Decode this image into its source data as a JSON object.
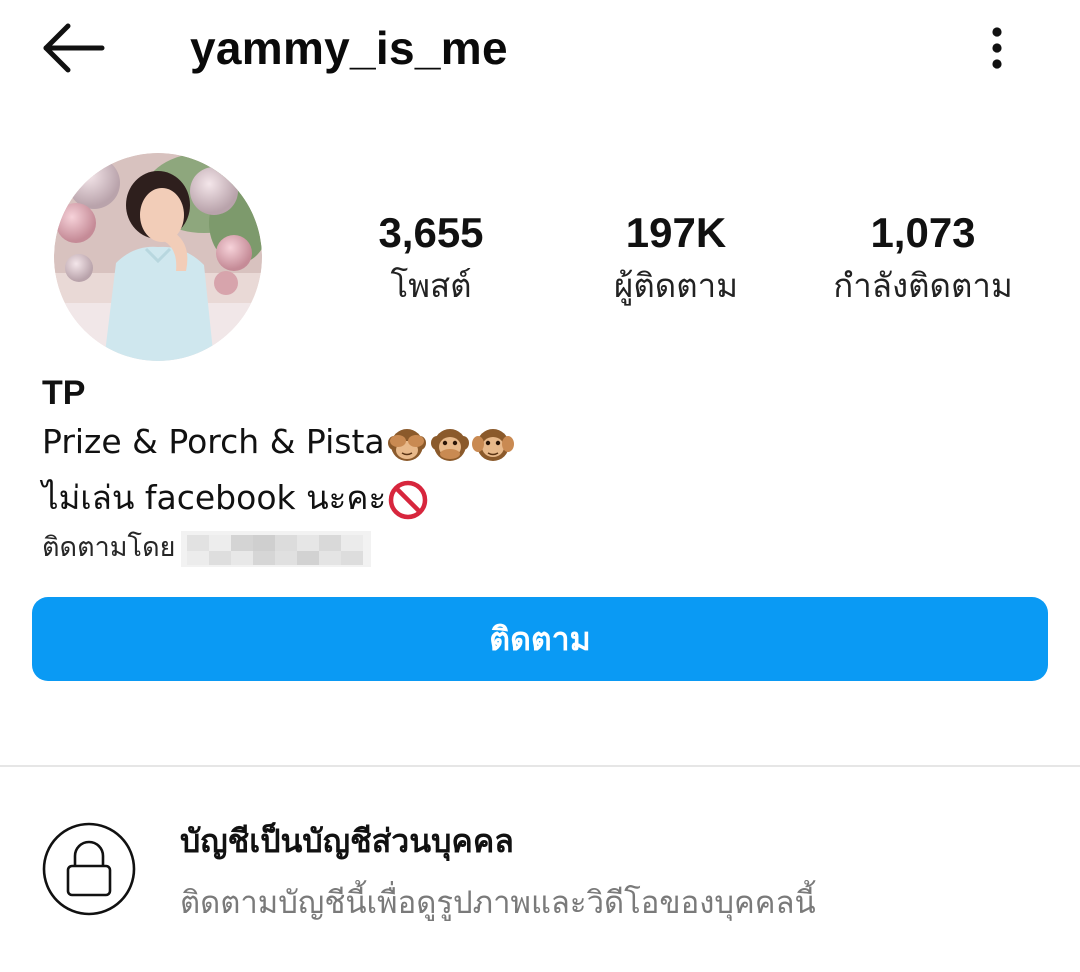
{
  "header": {
    "username": "yammy_is_me",
    "back_icon": "arrow-left-icon",
    "more_icon": "more-vertical-icon"
  },
  "profile": {
    "avatar_icon": "profile-photo",
    "stats": [
      {
        "value": "3,655",
        "label": "โพสต์"
      },
      {
        "value": "197K",
        "label": "ผู้ติดตาม"
      },
      {
        "value": "1,073",
        "label": "กำลังติดตาม"
      }
    ]
  },
  "bio": {
    "name": "TP",
    "line1": "Prize & Porch & Pista",
    "line1_emoji": [
      "see-no-evil-monkey",
      "speak-no-evil-monkey",
      "hear-no-evil-monkey"
    ],
    "line2": "ไม่เล่น facebook นะคะ",
    "line2_emoji": "no-entry-sign",
    "followed_by_label": "ติดตามโดย"
  },
  "follow_button": {
    "label": "ติดตาม"
  },
  "private_notice": {
    "icon": "lock-icon",
    "title": "บัญชีเป็นบัญชีส่วนบุคคล",
    "subtitle": "ติดตามบัญชีนี้เพื่อดูรูปภาพและวิดีโอของบุคคลนี้"
  },
  "colors": {
    "accent": "#0a9af4",
    "muted_text": "#7a7a7a",
    "divider": "#e6e6e6"
  }
}
